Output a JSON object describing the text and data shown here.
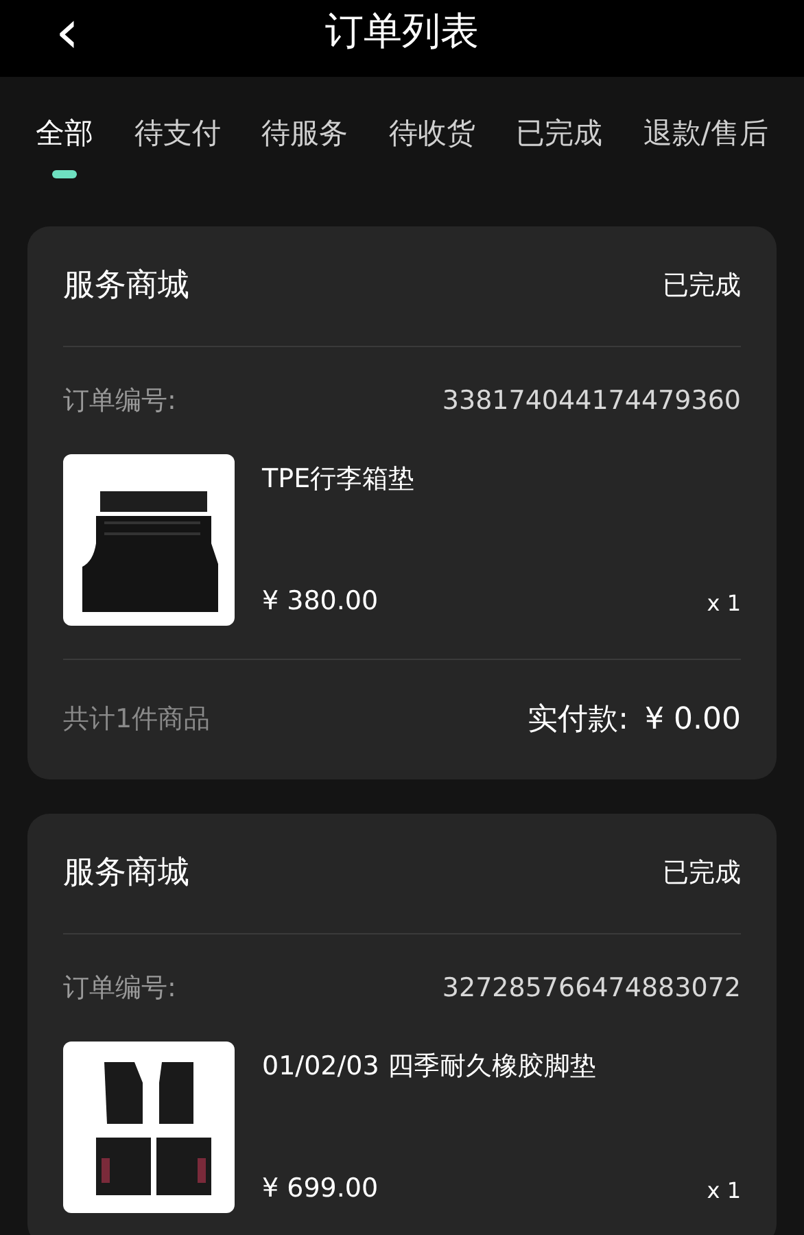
{
  "header": {
    "back": "‹",
    "title": "订单列表"
  },
  "tabs": [
    {
      "label": "全部",
      "selected": true
    },
    {
      "label": "待支付",
      "selected": false
    },
    {
      "label": "待服务",
      "selected": false
    },
    {
      "label": "待收货",
      "selected": false
    },
    {
      "label": "已完成",
      "selected": false
    },
    {
      "label": "退款/售后",
      "selected": false
    }
  ],
  "orders": [
    {
      "store": "服务商城",
      "status": "已完成",
      "order_label": "订单编号:",
      "order_number": "338174044174479360",
      "product": {
        "kind": "picture",
        "name": "TPE行李箱垫",
        "price": "¥ 380.00",
        "quantity": "x 1"
      },
      "footer": {
        "count": "共计1件商品",
        "paid_label": "实付款:",
        "paid": "¥ 0.00"
      }
    },
    {
      "store": "服务商城",
      "status": "已完成",
      "order_label": "订单编号:",
      "order_number": "327285766474883072",
      "product": {
        "kind": "picture",
        "name": "01/02/03 四季耐久橡胶脚垫",
        "price": "¥ 699.00",
        "quantity": "x 1"
      }
    }
  ]
}
